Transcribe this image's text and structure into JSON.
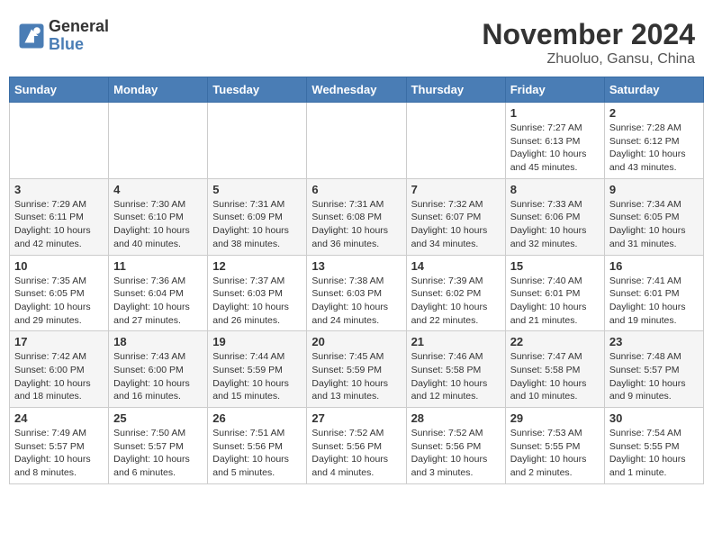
{
  "header": {
    "logo_general": "General",
    "logo_blue": "Blue",
    "month_year": "November 2024",
    "location": "Zhuoluo, Gansu, China"
  },
  "weekdays": [
    "Sunday",
    "Monday",
    "Tuesday",
    "Wednesday",
    "Thursday",
    "Friday",
    "Saturday"
  ],
  "weeks": [
    [
      {
        "day": "",
        "info": ""
      },
      {
        "day": "",
        "info": ""
      },
      {
        "day": "",
        "info": ""
      },
      {
        "day": "",
        "info": ""
      },
      {
        "day": "",
        "info": ""
      },
      {
        "day": "1",
        "info": "Sunrise: 7:27 AM\nSunset: 6:13 PM\nDaylight: 10 hours\nand 45 minutes."
      },
      {
        "day": "2",
        "info": "Sunrise: 7:28 AM\nSunset: 6:12 PM\nDaylight: 10 hours\nand 43 minutes."
      }
    ],
    [
      {
        "day": "3",
        "info": "Sunrise: 7:29 AM\nSunset: 6:11 PM\nDaylight: 10 hours\nand 42 minutes."
      },
      {
        "day": "4",
        "info": "Sunrise: 7:30 AM\nSunset: 6:10 PM\nDaylight: 10 hours\nand 40 minutes."
      },
      {
        "day": "5",
        "info": "Sunrise: 7:31 AM\nSunset: 6:09 PM\nDaylight: 10 hours\nand 38 minutes."
      },
      {
        "day": "6",
        "info": "Sunrise: 7:31 AM\nSunset: 6:08 PM\nDaylight: 10 hours\nand 36 minutes."
      },
      {
        "day": "7",
        "info": "Sunrise: 7:32 AM\nSunset: 6:07 PM\nDaylight: 10 hours\nand 34 minutes."
      },
      {
        "day": "8",
        "info": "Sunrise: 7:33 AM\nSunset: 6:06 PM\nDaylight: 10 hours\nand 32 minutes."
      },
      {
        "day": "9",
        "info": "Sunrise: 7:34 AM\nSunset: 6:05 PM\nDaylight: 10 hours\nand 31 minutes."
      }
    ],
    [
      {
        "day": "10",
        "info": "Sunrise: 7:35 AM\nSunset: 6:05 PM\nDaylight: 10 hours\nand 29 minutes."
      },
      {
        "day": "11",
        "info": "Sunrise: 7:36 AM\nSunset: 6:04 PM\nDaylight: 10 hours\nand 27 minutes."
      },
      {
        "day": "12",
        "info": "Sunrise: 7:37 AM\nSunset: 6:03 PM\nDaylight: 10 hours\nand 26 minutes."
      },
      {
        "day": "13",
        "info": "Sunrise: 7:38 AM\nSunset: 6:03 PM\nDaylight: 10 hours\nand 24 minutes."
      },
      {
        "day": "14",
        "info": "Sunrise: 7:39 AM\nSunset: 6:02 PM\nDaylight: 10 hours\nand 22 minutes."
      },
      {
        "day": "15",
        "info": "Sunrise: 7:40 AM\nSunset: 6:01 PM\nDaylight: 10 hours\nand 21 minutes."
      },
      {
        "day": "16",
        "info": "Sunrise: 7:41 AM\nSunset: 6:01 PM\nDaylight: 10 hours\nand 19 minutes."
      }
    ],
    [
      {
        "day": "17",
        "info": "Sunrise: 7:42 AM\nSunset: 6:00 PM\nDaylight: 10 hours\nand 18 minutes."
      },
      {
        "day": "18",
        "info": "Sunrise: 7:43 AM\nSunset: 6:00 PM\nDaylight: 10 hours\nand 16 minutes."
      },
      {
        "day": "19",
        "info": "Sunrise: 7:44 AM\nSunset: 5:59 PM\nDaylight: 10 hours\nand 15 minutes."
      },
      {
        "day": "20",
        "info": "Sunrise: 7:45 AM\nSunset: 5:59 PM\nDaylight: 10 hours\nand 13 minutes."
      },
      {
        "day": "21",
        "info": "Sunrise: 7:46 AM\nSunset: 5:58 PM\nDaylight: 10 hours\nand 12 minutes."
      },
      {
        "day": "22",
        "info": "Sunrise: 7:47 AM\nSunset: 5:58 PM\nDaylight: 10 hours\nand 10 minutes."
      },
      {
        "day": "23",
        "info": "Sunrise: 7:48 AM\nSunset: 5:57 PM\nDaylight: 10 hours\nand 9 minutes."
      }
    ],
    [
      {
        "day": "24",
        "info": "Sunrise: 7:49 AM\nSunset: 5:57 PM\nDaylight: 10 hours\nand 8 minutes."
      },
      {
        "day": "25",
        "info": "Sunrise: 7:50 AM\nSunset: 5:57 PM\nDaylight: 10 hours\nand 6 minutes."
      },
      {
        "day": "26",
        "info": "Sunrise: 7:51 AM\nSunset: 5:56 PM\nDaylight: 10 hours\nand 5 minutes."
      },
      {
        "day": "27",
        "info": "Sunrise: 7:52 AM\nSunset: 5:56 PM\nDaylight: 10 hours\nand 4 minutes."
      },
      {
        "day": "28",
        "info": "Sunrise: 7:52 AM\nSunset: 5:56 PM\nDaylight: 10 hours\nand 3 minutes."
      },
      {
        "day": "29",
        "info": "Sunrise: 7:53 AM\nSunset: 5:55 PM\nDaylight: 10 hours\nand 2 minutes."
      },
      {
        "day": "30",
        "info": "Sunrise: 7:54 AM\nSunset: 5:55 PM\nDaylight: 10 hours\nand 1 minute."
      }
    ]
  ]
}
